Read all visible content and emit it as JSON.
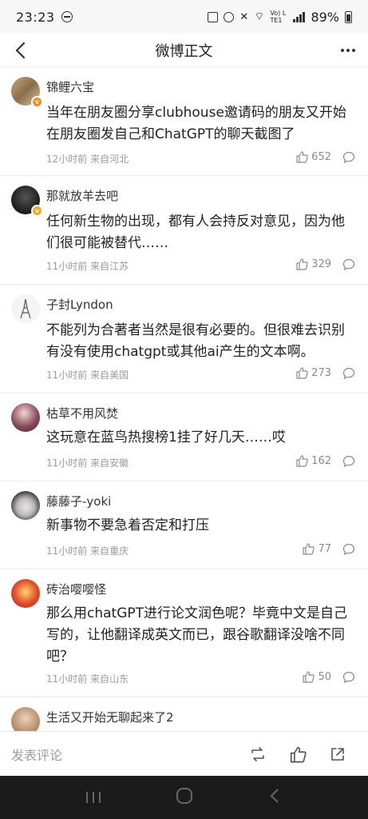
{
  "status_bar": {
    "time": "23:23",
    "battery": "89%",
    "network": "Vo) LTE1"
  },
  "header": {
    "title": "微博正文"
  },
  "comments": [
    {
      "user": "锦鲤六宝",
      "text": "当年在朋友圈分享clubhouse邀请码的朋友又开始在朋友圈发自己和ChatGPT的聊天截图了",
      "meta": "12小时前 来自河北",
      "likes": "652"
    },
    {
      "user": "那就放羊去吧",
      "text": "任何新生物的出现，都有人会持反对意见，因为他们很可能被替代……",
      "meta": "11小时前 来自江苏",
      "likes": "329"
    },
    {
      "user": "子封Lyndon",
      "text": "不能列为合著者当然是很有必要的。但很难去识别有没有使用chatgpt或其他ai产生的文本啊。",
      "meta": "11小时前 来自美国",
      "likes": "273"
    },
    {
      "user": "枯草不用风焚",
      "text": "这玩意在蓝鸟热搜榜1挂了好几天……哎",
      "meta": "11小时前 来自安徽",
      "likes": "162"
    },
    {
      "user": "藤藤子-yoki",
      "text": "新事物不要急着否定和打压",
      "meta": "11小时前 来自重庆",
      "likes": "77"
    },
    {
      "user": "砖治嘤嘤怪",
      "text": "那么用chatGPT进行论文润色呢？毕竟中文是自己写的，让他翻译成英文而已，跟谷歌翻译没啥不同吧？",
      "meta": "11小时前 来自山东",
      "likes": "50"
    },
    {
      "user": "生活又开始无聊起来了2",
      "text": "",
      "meta": "",
      "likes": ""
    }
  ],
  "bottom_bar": {
    "placeholder": "发表评论"
  },
  "colors": {
    "accent_badge": "#f4a823",
    "meta_text": "#9a9a9a",
    "sysnav_bg": "#1b1b1b"
  }
}
